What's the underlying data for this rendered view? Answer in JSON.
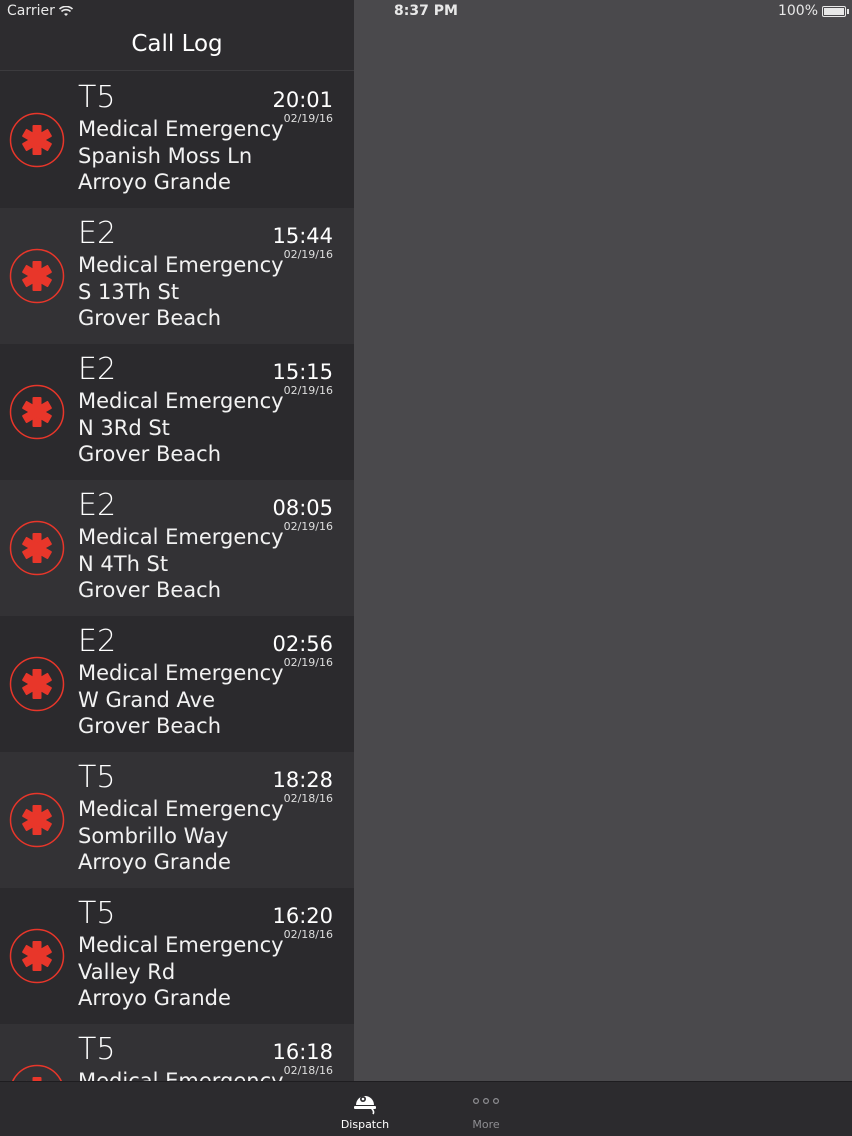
{
  "status_bar": {
    "carrier": "Carrier",
    "time": "8:37 PM",
    "battery": "100%"
  },
  "sidebar": {
    "title": "Call Log"
  },
  "calls": [
    {
      "unit": "T5",
      "type": "Medical Emergency",
      "street": "Spanish Moss Ln",
      "city": "Arroyo Grande",
      "time": "20:01",
      "date": "02/19/16"
    },
    {
      "unit": "E2",
      "type": "Medical Emergency",
      "street": "S 13Th St",
      "city": "Grover Beach",
      "time": "15:44",
      "date": "02/19/16"
    },
    {
      "unit": "E2",
      "type": "Medical Emergency",
      "street": "N 3Rd St",
      "city": "Grover Beach",
      "time": "15:15",
      "date": "02/19/16"
    },
    {
      "unit": "E2",
      "type": "Medical Emergency",
      "street": "N 4Th St",
      "city": "Grover Beach",
      "time": "08:05",
      "date": "02/19/16"
    },
    {
      "unit": "E2",
      "type": "Medical Emergency",
      "street": "W Grand Ave",
      "city": "Grover Beach",
      "time": "02:56",
      "date": "02/19/16"
    },
    {
      "unit": "T5",
      "type": "Medical Emergency",
      "street": "Sombrillo Way",
      "city": "Arroyo Grande",
      "time": "18:28",
      "date": "02/18/16"
    },
    {
      "unit": "T5",
      "type": "Medical Emergency",
      "street": "Valley Rd",
      "city": "Arroyo Grande",
      "time": "16:20",
      "date": "02/18/16"
    },
    {
      "unit": "T5",
      "type": "Medical Emergency",
      "street": "",
      "city": "",
      "time": "16:18",
      "date": "02/18/16"
    }
  ],
  "tabs": [
    {
      "label": "Dispatch",
      "icon": "alarm-bell-icon",
      "active": true
    },
    {
      "label": "More",
      "icon": "more-dots-icon",
      "active": false
    }
  ],
  "colors": {
    "accent": "#e8362a",
    "sidebar_bg": "#2b2a2d",
    "row_alt_bg": "#333235",
    "detail_bg": "#4a494c"
  }
}
